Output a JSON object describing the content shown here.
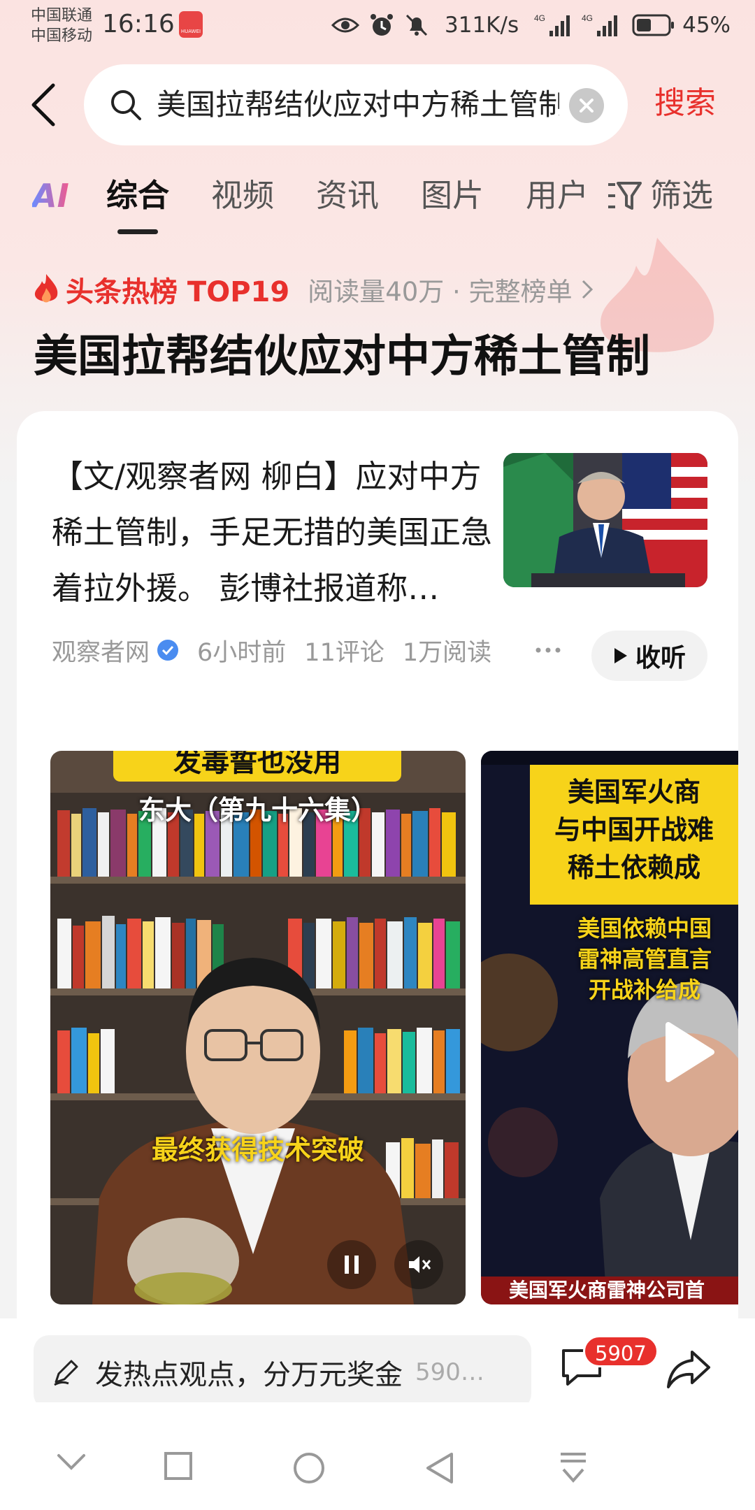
{
  "status_bar": {
    "carrier_1": "中国联通",
    "carrier_2": "中国移动",
    "time": "16:16",
    "badge_text": "HUAWEI",
    "net_speed": "311K/s",
    "battery": "45%",
    "icons": [
      "eye-icon",
      "alarm-icon",
      "mute-icon",
      "signal-4g-icon",
      "signal-4g-icon",
      "battery-icon"
    ]
  },
  "search": {
    "query": "美国拉帮结伙应对中方稀土管制",
    "submit_label": "搜索"
  },
  "tabs": {
    "ai": "AI",
    "items": [
      "综合",
      "视频",
      "资讯",
      "图片",
      "用户"
    ],
    "active": "综合",
    "filter": "筛选"
  },
  "hot_rank": {
    "label": "头条热榜 TOP19",
    "reads": "阅读量40万 · 完整榜单",
    "title": "美国拉帮结伙应对中方稀土管制"
  },
  "article": {
    "snippet": "【文/观察者网 柳白】应对中方稀土管制，手足无措的美国正急着拉外援。 彭博社报道称…",
    "source": "观察者网",
    "time": "6小时前",
    "comments": "11评论",
    "reads": "1万阅读",
    "listen_label": "收听"
  },
  "videos": [
    {
      "top_caption": "发毒誓也没用",
      "subtitle": "东大（第九十六集）",
      "caption": "最终获得技术突破"
    },
    {
      "headline_1": "美国军火商",
      "headline_2": "与中国开战难",
      "headline_3": "稀土依赖成",
      "sub_1": "美国依赖中国",
      "sub_2": "雷神高管直言",
      "sub_3": "开战补给成",
      "bottom_caption": "美国军火商雷神公司首"
    }
  ],
  "bottom_bar": {
    "comment_prompt": "发热点观点，分万元奖金",
    "comment_preview": "590…",
    "comment_count": "5907"
  },
  "colors": {
    "accent": "#e8302c",
    "header_bg": "#fbe3e1",
    "card_bg": "#ffffff"
  }
}
